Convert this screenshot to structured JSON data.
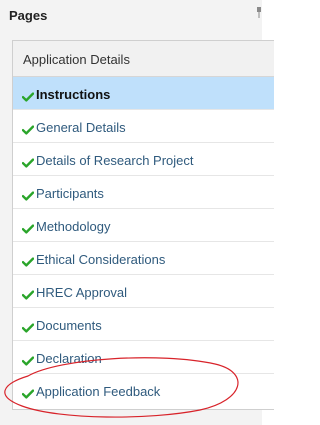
{
  "panel": {
    "title": "Pages",
    "pin_icon": "pin-icon"
  },
  "nav": {
    "section_label": "Application Details",
    "items": [
      {
        "label": "Instructions",
        "status": "complete",
        "active": true
      },
      {
        "label": "General Details",
        "status": "complete",
        "active": false
      },
      {
        "label": "Details of Research Project",
        "status": "complete",
        "active": false
      },
      {
        "label": "Participants",
        "status": "complete",
        "active": false
      },
      {
        "label": "Methodology",
        "status": "complete",
        "active": false
      },
      {
        "label": "Ethical Considerations",
        "status": "complete",
        "active": false
      },
      {
        "label": "HREC Approval",
        "status": "complete",
        "active": false
      },
      {
        "label": "Documents",
        "status": "complete",
        "active": false
      },
      {
        "label": "Declaration",
        "status": "complete",
        "active": false
      },
      {
        "label": "Application Feedback",
        "status": "complete",
        "active": false
      }
    ]
  },
  "colors": {
    "check": "#2aa52a",
    "active_bg": "#bfe0fb",
    "link_text": "#2f5a7d",
    "annotation": "#d8232a"
  },
  "icons": {
    "check": "check-icon"
  }
}
